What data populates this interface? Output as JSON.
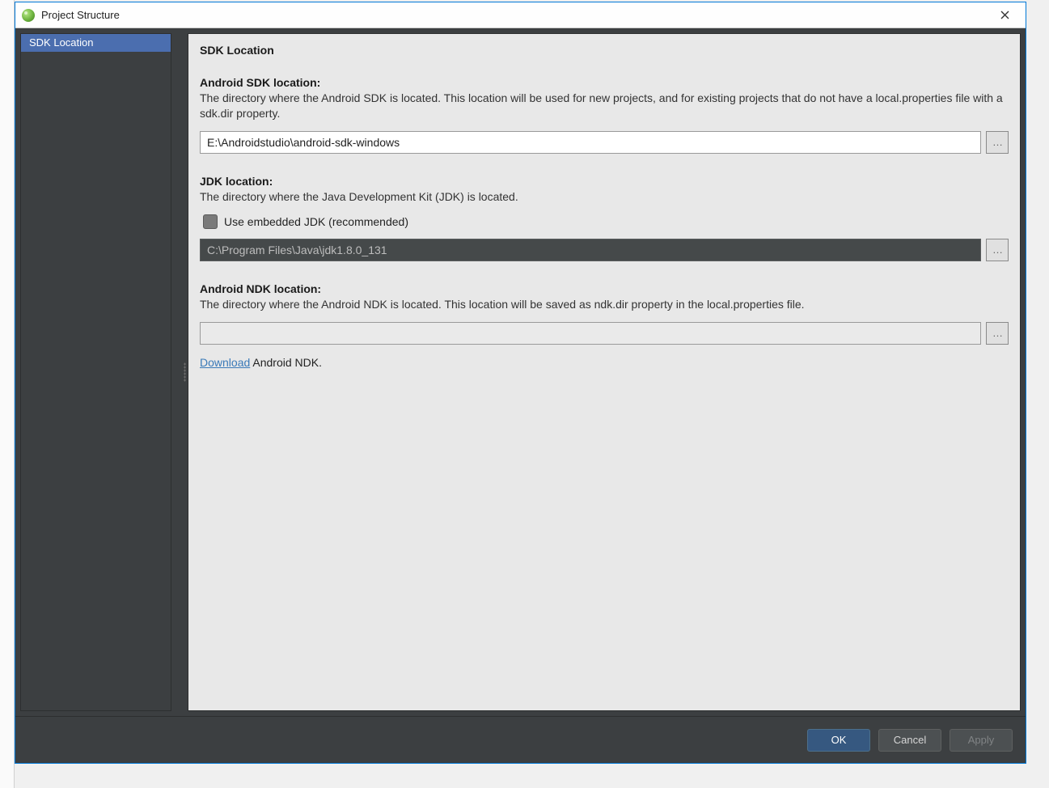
{
  "window": {
    "title": "Project Structure"
  },
  "sidebar": {
    "items": [
      {
        "label": "SDK Location",
        "selected": true
      }
    ]
  },
  "panel": {
    "title": "SDK Location",
    "sdk": {
      "label": "Android SDK location:",
      "desc": "The directory where the Android SDK is located. This location will be used for new projects, and for existing projects that do not have a local.properties file with a sdk.dir property.",
      "value": "E:\\Androidstudio\\android-sdk-windows",
      "browse": "…"
    },
    "jdk": {
      "label": "JDK location:",
      "desc": "The directory where the Java Development Kit (JDK) is located.",
      "checkbox_label": "Use embedded JDK (recommended)",
      "checked": false,
      "value": "C:\\Program Files\\Java\\jdk1.8.0_131",
      "browse": "…"
    },
    "ndk": {
      "label": "Android NDK location:",
      "desc": "The directory where the Android NDK is located. This location will be saved as ndk.dir property in the local.properties file.",
      "value": "",
      "browse": "…",
      "download_link": "Download",
      "download_rest": " Android NDK."
    }
  },
  "footer": {
    "ok": "OK",
    "cancel": "Cancel",
    "apply": "Apply"
  }
}
